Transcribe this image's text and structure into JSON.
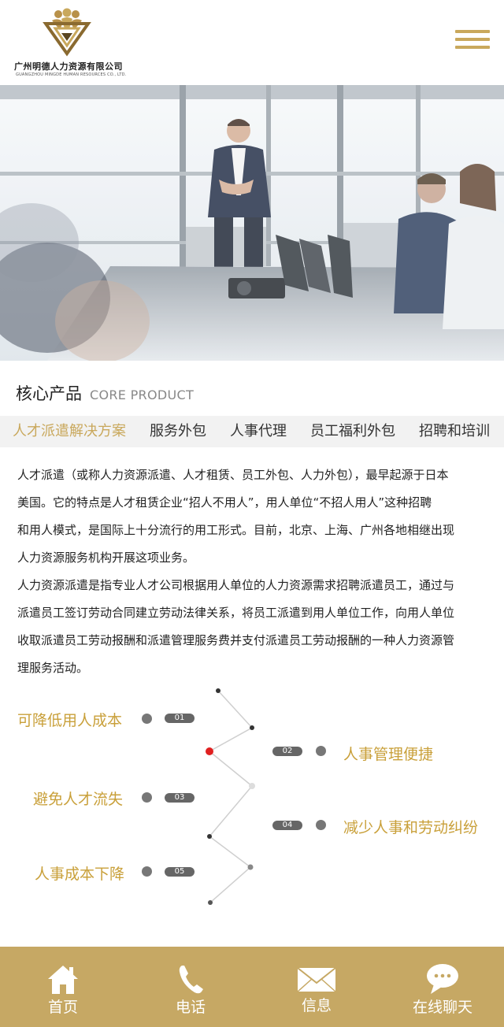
{
  "header": {
    "logo_name": "广州明德人力资源有限公司",
    "logo_sub": "GUANGZHOU MINGDE HUMAN RESOURCES CO., LTD.",
    "menu_icon": "hamburger-menu-icon",
    "accent_color": "#c9a85c"
  },
  "banner": {
    "alt": "office meeting presentation photo"
  },
  "section": {
    "title_cn": "核心产品",
    "title_en": "CORE PRODUCT"
  },
  "tabs": [
    {
      "label": "人才派遣解决方案",
      "active": true
    },
    {
      "label": "服务外包",
      "active": false
    },
    {
      "label": "人事代理",
      "active": false
    },
    {
      "label": "员工福利外包",
      "active": false
    },
    {
      "label": "招聘和培训",
      "active": false
    }
  ],
  "content": {
    "p1_lines": [
      "人才派遣（或称人力资源派遣、人才租赁、员工外包、人力外包），最早起源于日本",
      "美国。它的特点是人才租赁企业“招人不用人”，用人单位“不招人用人”这种招聘",
      "和用人模式，是国际上十分流行的用工形式。目前，北京、上海、广州各地相继出现",
      "人力资源服务机构开展这项业务。"
    ],
    "p2_lines": [
      "人力资源派遣是指专业人才公司根据用人单位的人力资源需求招聘派遣员工，通过与",
      "派遣员工签订劳动合同建立劳动法律关系，将员工派遣到用人单位工作，向用人单位",
      "收取派遣员工劳动报酬和派遣管理服务费并支付派遣员工劳动报酬的一种人力资源管",
      "理服务活动。"
    ]
  },
  "features": [
    {
      "num": "01",
      "label": "可降低用人成本"
    },
    {
      "num": "02",
      "label": "人事管理便捷"
    },
    {
      "num": "03",
      "label": "避免人才流失"
    },
    {
      "num": "04",
      "label": "减少人事和劳动纠纷"
    },
    {
      "num": "05",
      "label": "人事成本下降"
    }
  ],
  "footer": {
    "items": [
      {
        "label": "首页",
        "icon": "home-icon"
      },
      {
        "label": "电话",
        "icon": "phone-icon"
      },
      {
        "label": "信息",
        "icon": "mail-icon"
      },
      {
        "label": "在线聊天",
        "icon": "chat-icon"
      }
    ],
    "bg_color": "#c6a864"
  }
}
